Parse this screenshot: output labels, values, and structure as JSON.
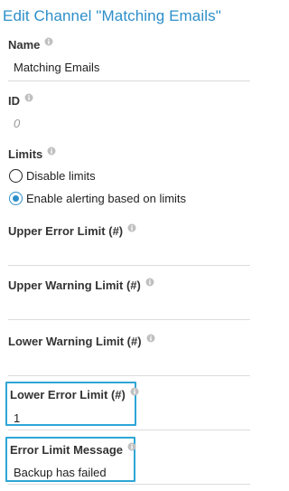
{
  "dialog": {
    "title": "Edit Channel \"Matching Emails\""
  },
  "fields": {
    "name": {
      "label": "Name",
      "value": "Matching Emails"
    },
    "id": {
      "label": "ID",
      "value": "0"
    },
    "limits": {
      "label": "Limits",
      "options": [
        {
          "label": "Disable limits",
          "selected": false
        },
        {
          "label": "Enable alerting based on limits",
          "selected": true
        }
      ]
    },
    "upper_error": {
      "label": "Upper Error Limit (#)",
      "value": ""
    },
    "upper_warning": {
      "label": "Upper Warning Limit (#)",
      "value": ""
    },
    "lower_warning": {
      "label": "Lower Warning Limit (#)",
      "value": ""
    },
    "lower_error": {
      "label": "Lower Error Limit (#)",
      "value": "1"
    },
    "error_message": {
      "label": "Error Limit Message",
      "value": "Backup has failed"
    }
  },
  "colors": {
    "accent": "#2d8fc9",
    "highlight": "#2da6d6",
    "info_icon": "#c0c0c0"
  }
}
